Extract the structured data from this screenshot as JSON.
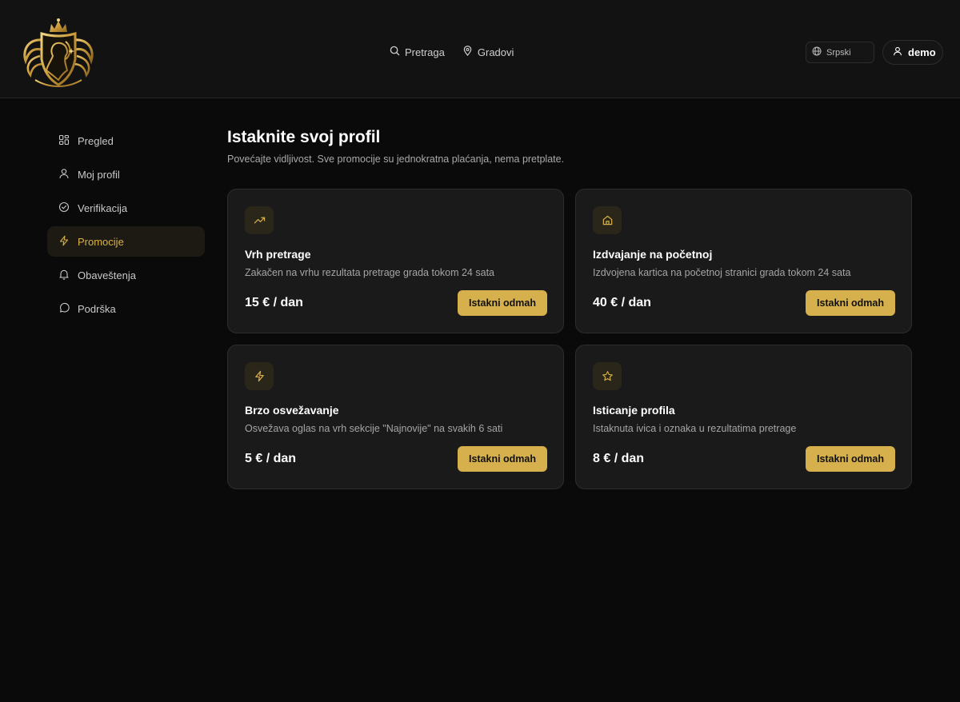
{
  "header": {
    "nav": [
      {
        "label": "Pretraga",
        "icon": "search-icon"
      },
      {
        "label": "Gradovi",
        "icon": "map-pin-icon"
      }
    ],
    "language": {
      "label": "Srpski",
      "icon": "globe-icon"
    },
    "user": {
      "label": "demo",
      "icon": "user-icon"
    }
  },
  "sidebar": {
    "items": [
      {
        "label": "Pregled",
        "icon": "grid-icon"
      },
      {
        "label": "Moj profil",
        "icon": "user-icon"
      },
      {
        "label": "Verifikacija",
        "icon": "check-circle-icon"
      },
      {
        "label": "Promocije",
        "icon": "bolt-icon",
        "active": true
      },
      {
        "label": "Obaveštenja",
        "icon": "bell-icon"
      },
      {
        "label": "Podrška",
        "icon": "chat-icon"
      }
    ]
  },
  "main": {
    "title": "Istaknite svoj profil",
    "subtitle": "Povećajte vidljivost. Sve promocije su jednokratna plaćanja, nema pretplate.",
    "cards": [
      {
        "title": "Vrh pretrage",
        "desc": "Zakačen na vrhu rezultata pretrage grada tokom 24 sata",
        "price": "15 € / dan",
        "button": "Istakni odmah",
        "icon": "trending-up-icon"
      },
      {
        "title": "Izdvajanje na početnoj",
        "desc": "Izdvojena kartica na početnoj stranici grada tokom 24 sata",
        "price": "40 € / dan",
        "button": "Istakni odmah",
        "icon": "home-icon"
      },
      {
        "title": "Brzo osvežavanje",
        "desc": "Osvežava oglas na vrh sekcije \"Najnovije\" na svakih 6 sati",
        "price": "5 € / dan",
        "button": "Istakni odmah",
        "icon": "bolt-icon"
      },
      {
        "title": "Isticanje profila",
        "desc": "Istaknuta ivica i oznaka u rezultatima pretrage",
        "price": "8 € / dan",
        "button": "Istakni odmah",
        "icon": "star-icon"
      }
    ]
  },
  "colors": {
    "accent": "#d6b04d",
    "background": "#0a0a0a",
    "card": "#1a1a1a"
  }
}
